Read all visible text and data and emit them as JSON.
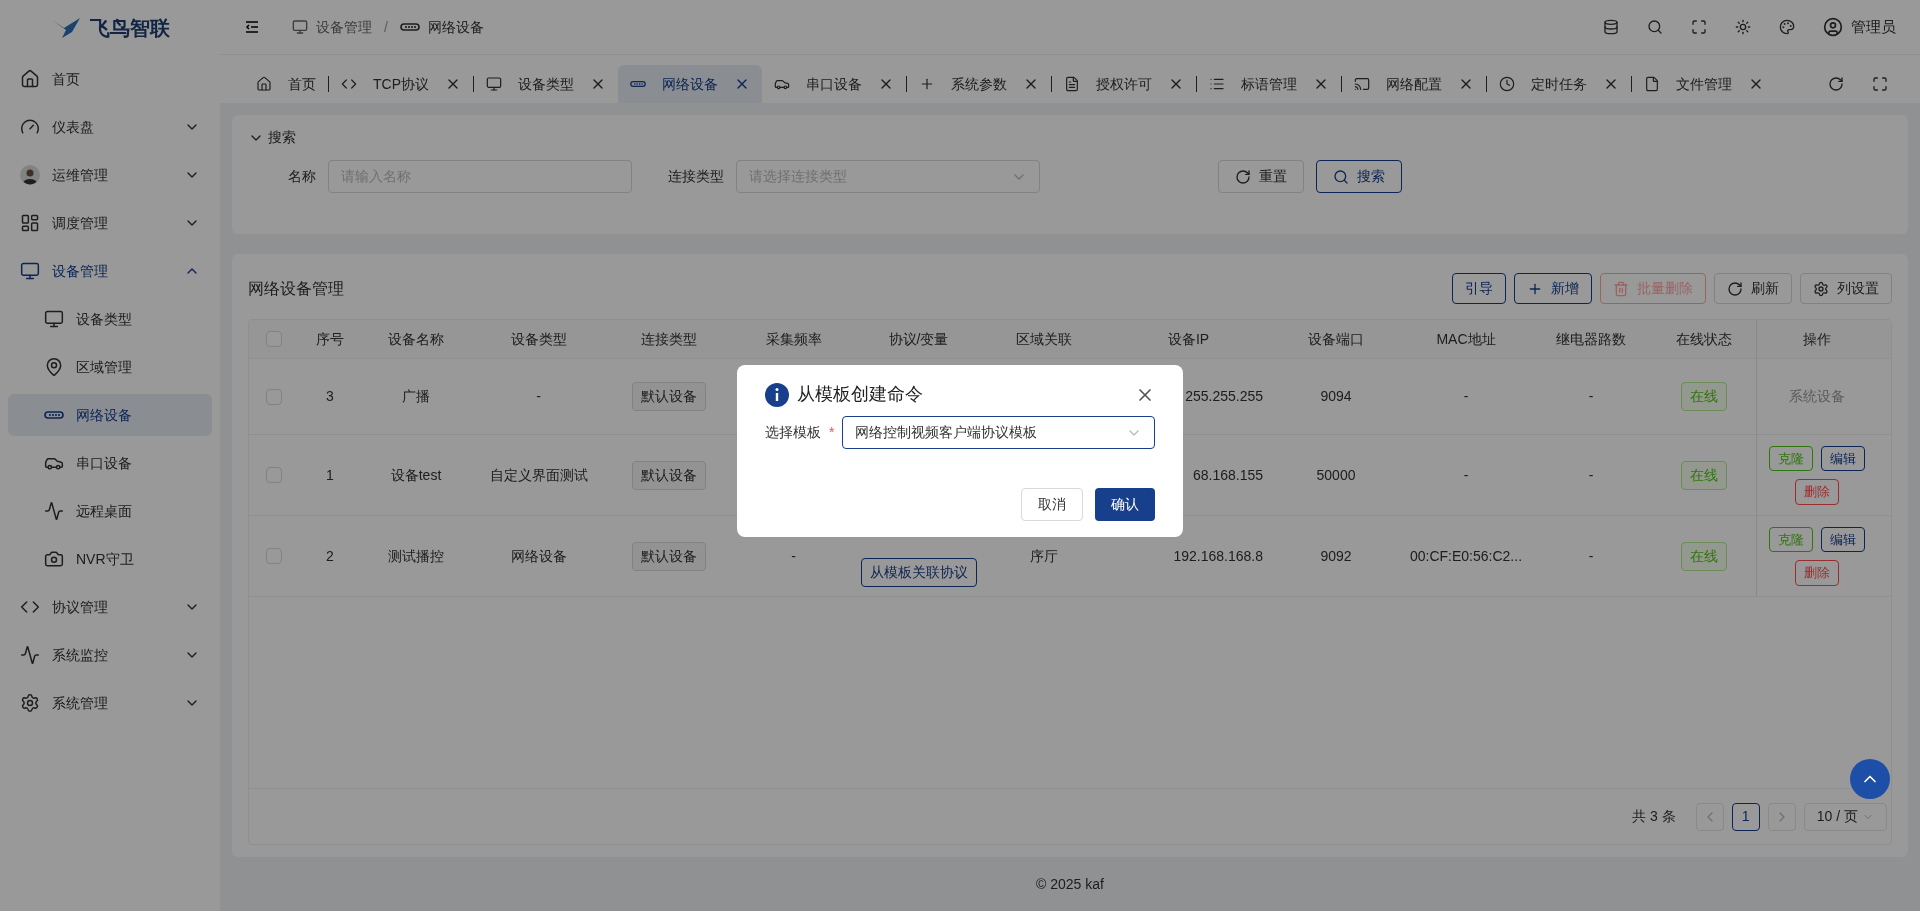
{
  "app": {
    "logo_text": "飞鸟智联"
  },
  "header": {
    "breadcrumb": [
      "设备管理",
      "网络设备"
    ],
    "separator": "/",
    "user": "管理员"
  },
  "sidebar": {
    "items": [
      {
        "label": "首页",
        "kind": "link",
        "selected": false
      },
      {
        "label": "仪表盘",
        "kind": "group",
        "expanded": false,
        "selected": false
      },
      {
        "label": "运维管理",
        "kind": "group",
        "expanded": false,
        "selected": false
      },
      {
        "label": "调度管理",
        "kind": "group",
        "expanded": false,
        "selected": false
      },
      {
        "label": "设备管理",
        "kind": "group",
        "expanded": true,
        "selected": true,
        "children": [
          {
            "label": "设备类型",
            "selected": false
          },
          {
            "label": "区域管理",
            "selected": false
          },
          {
            "label": "网络设备",
            "selected": true
          },
          {
            "label": "串口设备",
            "selected": false
          },
          {
            "label": "远程桌面",
            "selected": false
          },
          {
            "label": "NVR守卫",
            "selected": false
          }
        ]
      },
      {
        "label": "协议管理",
        "kind": "group",
        "expanded": false,
        "selected": false
      },
      {
        "label": "系统监控",
        "kind": "group",
        "expanded": false,
        "selected": false
      },
      {
        "label": "系统管理",
        "kind": "group",
        "expanded": false,
        "selected": false
      }
    ]
  },
  "tabs": [
    {
      "label": "首页",
      "selected": false,
      "closable": false
    },
    {
      "label": "TCP协议",
      "selected": false,
      "closable": true
    },
    {
      "label": "设备类型",
      "selected": false,
      "closable": true
    },
    {
      "label": "网络设备",
      "selected": true,
      "closable": true
    },
    {
      "label": "串口设备",
      "selected": false,
      "closable": true
    },
    {
      "label": "系统参数",
      "selected": false,
      "closable": true
    },
    {
      "label": "授权许可",
      "selected": false,
      "closable": true
    },
    {
      "label": "标语管理",
      "selected": false,
      "closable": true
    },
    {
      "label": "网络配置",
      "selected": false,
      "closable": true
    },
    {
      "label": "定时任务",
      "selected": false,
      "closable": true
    },
    {
      "label": "文件管理",
      "selected": false,
      "closable": true
    }
  ],
  "search": {
    "title": "搜索",
    "expanded": true,
    "fields": [
      {
        "label": "名称",
        "placeholder": "请输入名称",
        "kind": "input"
      },
      {
        "label": "连接类型",
        "placeholder": "请选择连接类型",
        "kind": "select"
      }
    ],
    "buttons": [
      {
        "label": "重置",
        "kind": "default"
      },
      {
        "label": "搜索",
        "kind": "primary"
      }
    ]
  },
  "table": {
    "title": "网络设备管理",
    "toolbar": [
      {
        "label": "引导",
        "kind": "outline",
        "disabled": false
      },
      {
        "label": "新增",
        "kind": "add",
        "disabled": false
      },
      {
        "label": "批量删除",
        "kind": "delete",
        "disabled": true
      },
      {
        "label": "刷新",
        "kind": "refresh",
        "disabled": false
      },
      {
        "label": "列设置",
        "kind": "settings",
        "disabled": false
      }
    ],
    "select_all_checked": false,
    "columns": [
      "序号",
      "设备名称",
      "设备类型",
      "连接类型",
      "采集频率",
      "协议/变量",
      "区域关联",
      "设备IP",
      "设备端口",
      "MAC地址",
      "继电器路数",
      "在线状态",
      "操作"
    ],
    "rows": [
      {
        "checked": false,
        "cells": [
          {
            "kind": "text",
            "text": "3"
          },
          {
            "kind": "text",
            "text": "广播"
          },
          {
            "kind": "text",
            "text": "-"
          },
          {
            "kind": "tag",
            "text": "默认设备"
          },
          null,
          null,
          null,
          {
            "kind": "ip",
            "text": "255.255.255"
          },
          {
            "kind": "text",
            "text": "9094"
          },
          {
            "kind": "text",
            "text": "-"
          },
          {
            "kind": "text",
            "text": "-"
          },
          {
            "kind": "status",
            "text": "在线"
          },
          {
            "kind": "muted",
            "text": "系统设备"
          }
        ]
      },
      {
        "checked": false,
        "cells": [
          {
            "kind": "text",
            "text": "1"
          },
          {
            "kind": "text",
            "text": "设备test"
          },
          {
            "kind": "text",
            "text": "自定义界面测试"
          },
          {
            "kind": "tag",
            "text": "默认设备"
          },
          null,
          null,
          null,
          {
            "kind": "ip",
            "text": "68.168.155"
          },
          {
            "kind": "text",
            "text": "50000"
          },
          {
            "kind": "text",
            "text": "-"
          },
          {
            "kind": "text",
            "text": "-"
          },
          {
            "kind": "status",
            "text": "在线"
          },
          {
            "kind": "actions",
            "buttons": [
              {
                "label": "克隆",
                "kind": "success"
              },
              {
                "label": "编辑",
                "kind": "primary"
              },
              {
                "label": "删除",
                "kind": "danger"
              }
            ]
          }
        ]
      },
      {
        "checked": false,
        "cells": [
          {
            "kind": "text",
            "text": "2"
          },
          {
            "kind": "text",
            "text": "测试播控"
          },
          {
            "kind": "text",
            "text": "网络设备"
          },
          {
            "kind": "tag",
            "text": "默认设备"
          },
          {
            "kind": "text",
            "text": "-"
          },
          {
            "kind": "link",
            "text": "从模板关联协议"
          },
          {
            "kind": "text",
            "text": "序厅"
          },
          {
            "kind": "ip",
            "text": "192.168.168.8"
          },
          {
            "kind": "text",
            "text": "9092"
          },
          {
            "kind": "text",
            "text": "00:CF:E0:56:C2..."
          },
          {
            "kind": "text",
            "text": "-"
          },
          {
            "kind": "status",
            "text": "在线"
          },
          {
            "kind": "actions",
            "buttons": [
              {
                "label": "克隆",
                "kind": "success"
              },
              {
                "label": "编辑",
                "kind": "primary"
              },
              {
                "label": "删除",
                "kind": "danger"
              }
            ]
          }
        ]
      }
    ],
    "pagination": {
      "total": "共 3 条",
      "pages": [
        {
          "label": "1",
          "selected": true
        }
      ],
      "page_size": "10 / 页"
    }
  },
  "modal": {
    "title": "从模板创建命令",
    "field": {
      "label": "选择模板",
      "required": true,
      "required_mark": "*",
      "value": "网络控制视频客户端协议模板"
    },
    "buttons": [
      {
        "label": "取消",
        "kind": "default"
      },
      {
        "label": "确认",
        "kind": "primary"
      }
    ]
  },
  "footer": "© 2025 kaf"
}
